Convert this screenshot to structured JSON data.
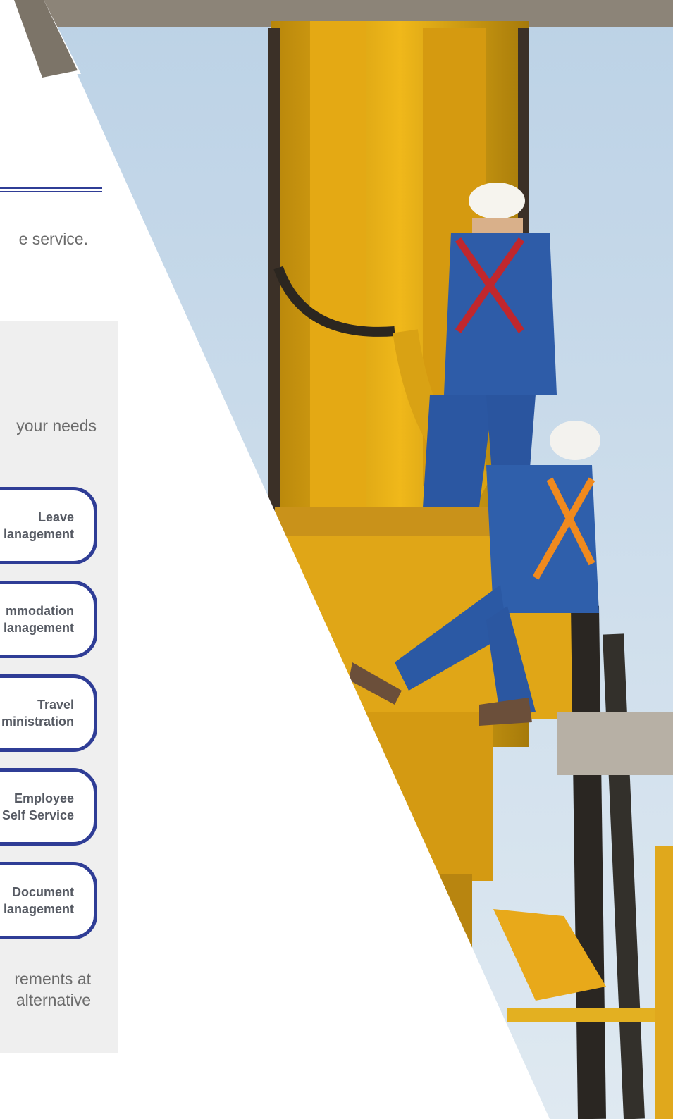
{
  "intro": {
    "tagline_fragment": "e service."
  },
  "options": {
    "needs_fragment": "your needs"
  },
  "modules": [
    {
      "line1": "Leave",
      "line2": "lanagement"
    },
    {
      "line1": "mmodation",
      "line2": "lanagement"
    },
    {
      "line1": "Travel",
      "line2": "ministration"
    },
    {
      "line1": "Employee",
      "line2": "Self Service"
    },
    {
      "line1": "Document",
      "line2": "lanagement"
    }
  ],
  "footer": {
    "line1": "rements at",
    "line2": "alternative"
  },
  "colors": {
    "brand_blue": "#2f3d96",
    "text_gray": "#6b6b6b",
    "module_text": "#565a63",
    "panel_gray": "#efefef"
  }
}
